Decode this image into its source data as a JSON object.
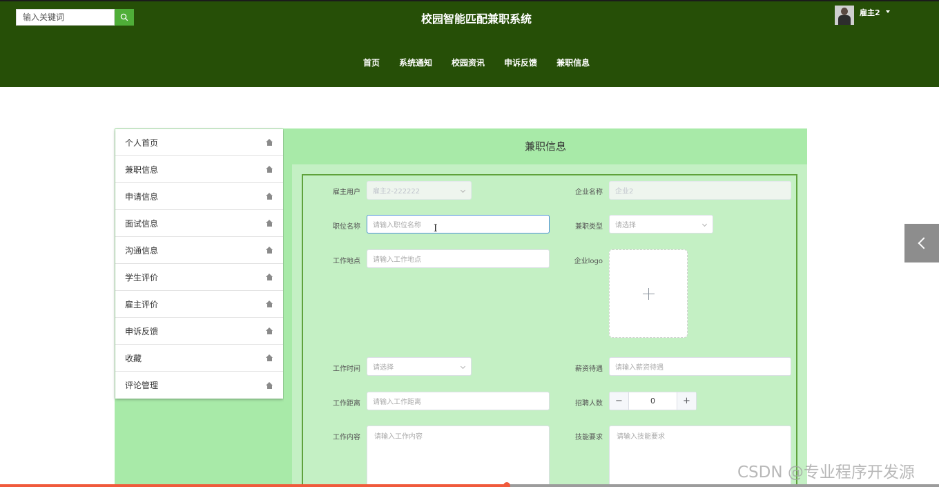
{
  "header": {
    "search_placeholder": "输入关键词",
    "title": "校园智能匹配兼职系统",
    "user_name": "雇主2",
    "nav": [
      "首页",
      "系统通知",
      "校园资讯",
      "申诉反馈",
      "兼职信息"
    ]
  },
  "sidebar": {
    "items": [
      "个人首页",
      "兼职信息",
      "申请信息",
      "面试信息",
      "沟通信息",
      "学生评价",
      "雇主评价",
      "申诉反馈",
      "收藏",
      "评论管理"
    ]
  },
  "main": {
    "title": "兼职信息",
    "form": {
      "employer_user": {
        "label": "雇主用户",
        "value": "雇主2-222222"
      },
      "company_name": {
        "label": "企业名称",
        "value": "企业2"
      },
      "job_name": {
        "label": "职位名称",
        "placeholder": "请输入职位名称"
      },
      "job_type": {
        "label": "兼职类型",
        "placeholder": "请选择"
      },
      "work_location": {
        "label": "工作地点",
        "placeholder": "请输入工作地点"
      },
      "company_logo": {
        "label": "企业logo"
      },
      "work_time": {
        "label": "工作时间",
        "placeholder": "请选择"
      },
      "salary": {
        "label": "薪资待遇",
        "placeholder": "请输入薪资待遇"
      },
      "work_distance": {
        "label": "工作距离",
        "placeholder": "请输入工作距离"
      },
      "headcount": {
        "label": "招聘人数",
        "value": "0",
        "minus": "−",
        "plus": "+"
      },
      "work_content": {
        "label": "工作内容",
        "placeholder": "请输入工作内容"
      },
      "skill_requirements": {
        "label": "技能要求",
        "placeholder": "请输入技能要求"
      }
    }
  },
  "video_progress": 0.54,
  "watermark": "CSDN @专业程序开发源",
  "colors": {
    "header_bg": "#264f07",
    "panel_bg": "#a8eaa8",
    "form_bg": "#c4f0c4",
    "frame_border": "#5fa23c",
    "search_btn": "#4fae38"
  }
}
